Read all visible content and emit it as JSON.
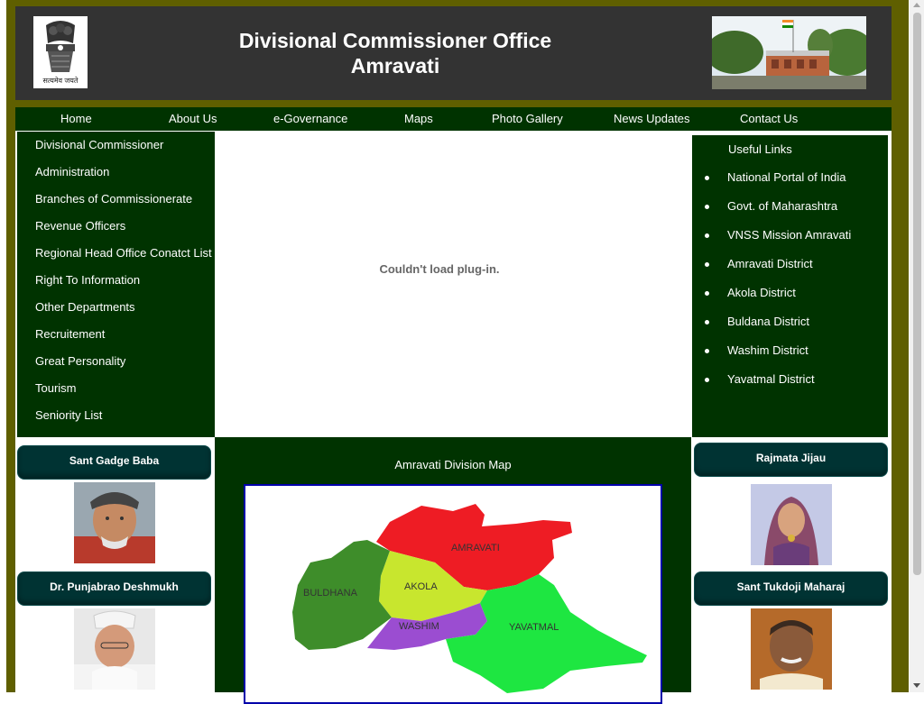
{
  "header": {
    "title_line1": "Divisional Commissioner Office",
    "title_line2": "Amravati",
    "emblem_caption": "सत्यमेव जयते"
  },
  "nav": {
    "items": [
      "Home",
      "About Us",
      "e-Governance",
      "Maps",
      "Photo Gallery",
      "News Updates",
      "Contact Us"
    ]
  },
  "sidebar": {
    "items": [
      "Divisional Commissioner",
      "Administration",
      "Branches of Commissionerate",
      "Revenue Officers",
      "Regional Head Office Conatct List",
      "Right To Information",
      "Other Departments",
      "Recruitement",
      "Great Personality",
      "Tourism",
      "Seniority List"
    ]
  },
  "plugin": {
    "message": "Couldn't load plug-in."
  },
  "useful_links": {
    "title": "Useful Links",
    "items": [
      "National Portal of India",
      "Govt. of Maharashtra",
      "VNSS Mission Amravati",
      "Amravati District",
      "Akola District",
      "Buldana District",
      "Washim District",
      "Yavatmal District"
    ]
  },
  "map": {
    "title": "Amravati Division Map",
    "districts": [
      "AMRAVATI",
      "AKOLA",
      "BULDHANA",
      "WASHIM",
      "YAVATMAL"
    ]
  },
  "personalities": {
    "left": [
      "Sant Gadge Baba",
      "Dr. Punjabrao Deshmukh"
    ],
    "right": [
      "Rajmata Jijau",
      "Sant Tukdoji Maharaj"
    ]
  },
  "colors": {
    "frame": "#5f5f00",
    "header_bg": "#333333",
    "dark_green": "#003300",
    "button_teal": "#003333"
  }
}
